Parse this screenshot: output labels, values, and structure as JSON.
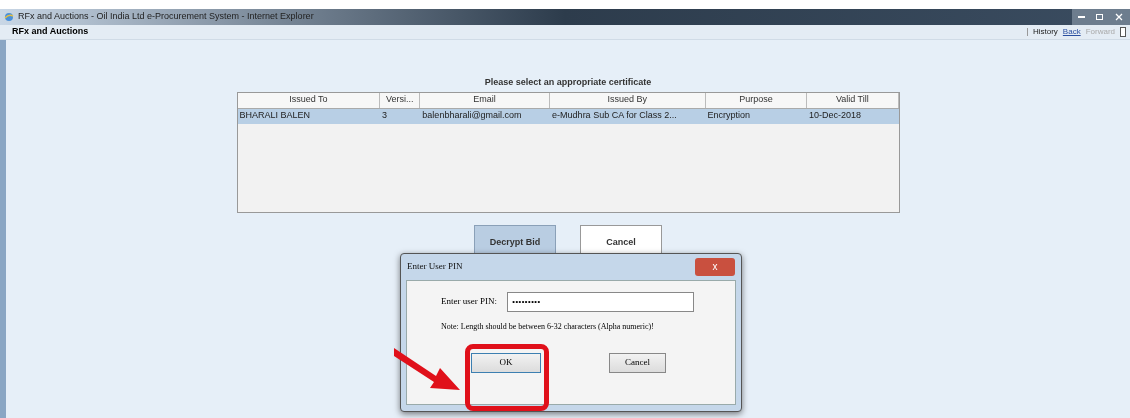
{
  "window": {
    "title": "RFx and Auctions - Oil India Ltd e-Procurement System - Internet Explorer"
  },
  "toolbar": {
    "title": "RFx and Auctions",
    "history": "History",
    "back": "Back",
    "forward": "Forward"
  },
  "certificate_table": {
    "heading": "Please select an appropriate certificate",
    "columns": [
      "Issued To",
      "Versi...",
      "Email",
      "Issued By",
      "Purpose",
      "Valid Till"
    ],
    "rows": [
      {
        "cells": [
          "BHARALI BALEN",
          "3",
          "balenbharali@gmail.com",
          "e-Mudhra Sub CA for Class 2...",
          "Encryption",
          "10-Dec-2018"
        ],
        "selected": true
      }
    ]
  },
  "buttons": [
    {
      "label": "Decrypt Bid",
      "pressed": true
    },
    {
      "label": "Cancel",
      "pressed": false
    }
  ],
  "pin_dialog": {
    "title": "Enter User PIN",
    "close": "x",
    "field_label": "Enter user PIN:",
    "value": "•••••••••",
    "note": "Note: Length should be between 6-32 characters (Alpha numeric)!",
    "ok": "OK",
    "cancel": "Cancel"
  }
}
